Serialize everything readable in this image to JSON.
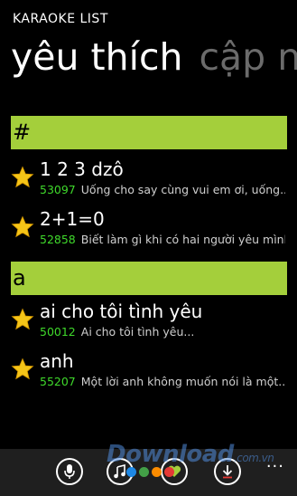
{
  "app_title": "KARAOKE LIST",
  "pivot": {
    "active": "yêu thích",
    "inactive": "cập n"
  },
  "groups": [
    {
      "header": "#",
      "items": [
        {
          "title": "1 2 3 dzô",
          "code": "53097",
          "desc": "Uống cho say cùng vui em ơi, uống..."
        },
        {
          "title": "2+1=0",
          "code": "52858",
          "desc": "Biết làm gì khi có hai người yêu mình,..."
        }
      ]
    },
    {
      "header": "a",
      "items": [
        {
          "title": "ai cho tôi tình yêu",
          "code": "50012",
          "desc": "Ai cho tôi tình yêu..."
        },
        {
          "title": "anh",
          "code": "55207",
          "desc": "Một lời anh không muốn nói là một..."
        }
      ]
    }
  ],
  "appbar": {
    "more": "..."
  },
  "watermark": {
    "main": "Download",
    "suffix": ".com.vn"
  },
  "colors": {
    "accent": "#a4cf3b",
    "code": "#3fd92b",
    "star": "#f5c518"
  }
}
